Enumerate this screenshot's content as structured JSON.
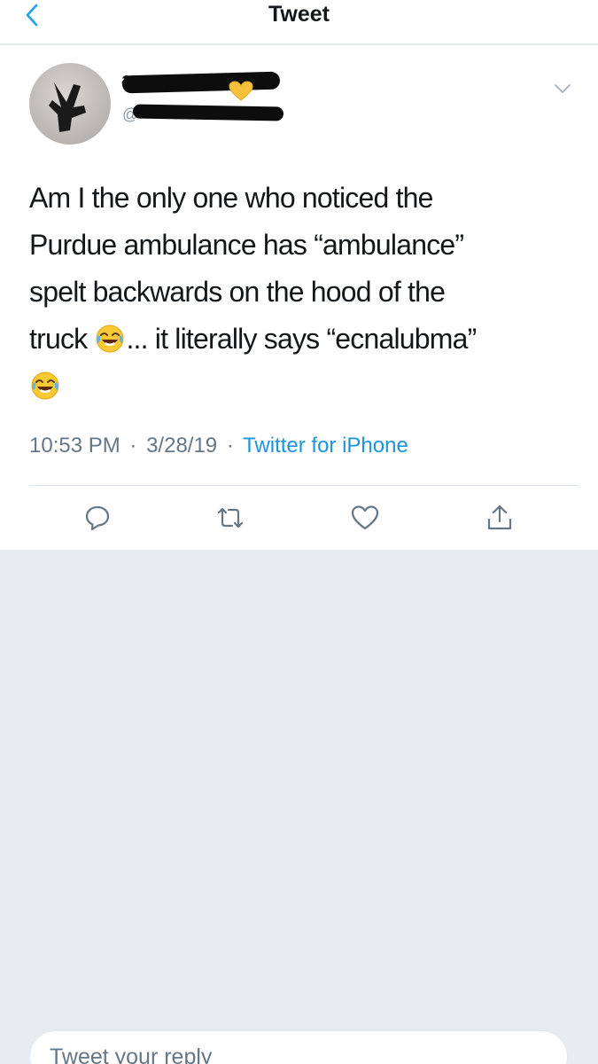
{
  "header": {
    "title": "Tweet",
    "back_icon": "chevron-left-icon"
  },
  "tweet": {
    "author": {
      "display_name": "a",
      "handle": "@",
      "name_emoji": "yellow-heart",
      "redacted": true
    },
    "body": {
      "line1": "Am I the only one who noticed the",
      "line2": "Purdue ambulance has “ambulance”",
      "line3": "spelt backwards on the hood of the",
      "line4_before": "truck ",
      "line4_after": "... it literally says “ecnalubma”"
    },
    "emoji": "face-with-tears-of-joy",
    "time": "10:53 PM",
    "sep1": "·",
    "date": "3/28/19",
    "sep2": "·",
    "source": "Twitter for iPhone"
  },
  "actions": [
    "reply-icon",
    "retweet-icon",
    "like-icon",
    "share-icon"
  ],
  "reply": {
    "placeholder": "Tweet your reply"
  },
  "colors": {
    "accent": "#1b95e0",
    "text": "#14171a",
    "muted": "#657786",
    "background": "#e6ecf0"
  }
}
